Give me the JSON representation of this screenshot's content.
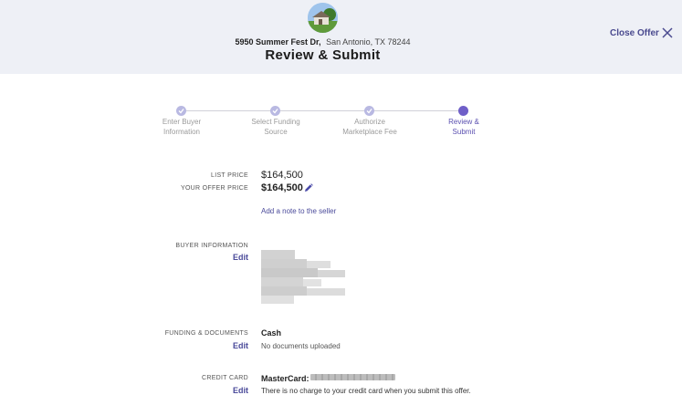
{
  "header": {
    "address_street": "5950 Summer Fest Dr,",
    "address_city": "San Antonio, TX 78244",
    "title": "Review & Submit",
    "close_label": "Close Offer",
    "close_icon": "close-icon",
    "property_image": "house-thumbnail"
  },
  "steps": [
    {
      "line1": "Enter Buyer",
      "line2": "Information",
      "state": "done"
    },
    {
      "line1": "Select Funding",
      "line2": "Source",
      "state": "done"
    },
    {
      "line1": "Authorize",
      "line2": "Marketplace Fee",
      "state": "done"
    },
    {
      "line1": "Review &",
      "line2": "Submit",
      "state": "active"
    }
  ],
  "pricing": {
    "list_price_label": "LIST PRICE",
    "list_price": "$164,500",
    "offer_price_label": "YOUR OFFER PRICE",
    "offer_price": "$164,500",
    "add_note": "Add a note to the seller"
  },
  "buyer": {
    "label": "BUYER INFORMATION",
    "edit": "Edit"
  },
  "funding": {
    "label": "FUNDING & DOCUMENTS",
    "edit": "Edit",
    "type": "Cash",
    "documents": "No documents uploaded"
  },
  "credit_card": {
    "label": "CREDIT CARD",
    "edit": "Edit",
    "brand": "MasterCard:",
    "note": "There is no charge to your credit card when you submit this offer."
  },
  "colors": {
    "header_bg": "#eef0f6",
    "accent": "#6f5fc8",
    "link": "#4a4a9a"
  }
}
